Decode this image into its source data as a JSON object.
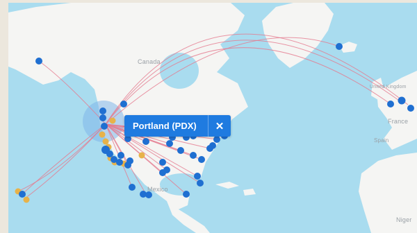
{
  "popup": {
    "title": "Portland (PDX)",
    "close_glyph": "✕"
  },
  "labels": {
    "canada": "Canada",
    "mexico": "Mexico",
    "france": "France",
    "spain": "Spain",
    "niger": "Niger",
    "uk": "United Kingdom"
  },
  "colors": {
    "water": "#a9dcef",
    "land": "#f5f5f3",
    "route": "#e57b8f",
    "airport_primary": "#1f6fd1",
    "airport_secondary": "#e7b24a",
    "popup": "#1f7be0"
  },
  "icons": {
    "close": "close-icon",
    "airport": "airport-marker-icon"
  }
}
